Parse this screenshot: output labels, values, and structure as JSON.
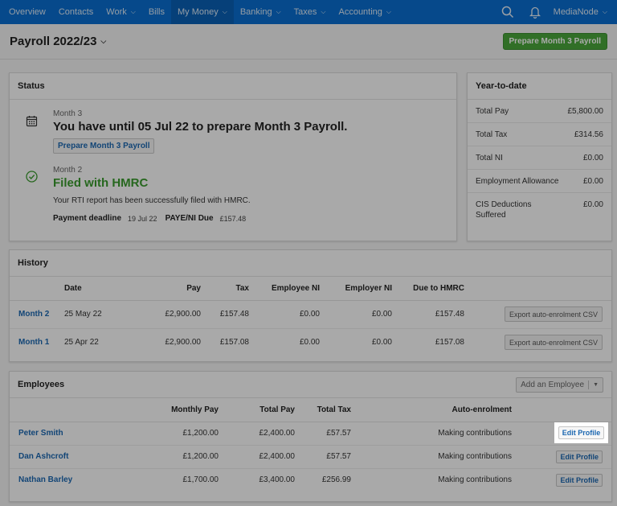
{
  "nav": {
    "items": [
      {
        "label": "Overview",
        "has_caret": false,
        "active": false
      },
      {
        "label": "Contacts",
        "has_caret": false,
        "active": false
      },
      {
        "label": "Work",
        "has_caret": true,
        "active": false
      },
      {
        "label": "Bills",
        "has_caret": false,
        "active": false
      },
      {
        "label": "My Money",
        "has_caret": true,
        "active": true
      },
      {
        "label": "Banking",
        "has_caret": true,
        "active": false
      },
      {
        "label": "Taxes",
        "has_caret": true,
        "active": false
      },
      {
        "label": "Accounting",
        "has_caret": true,
        "active": false
      }
    ],
    "search_icon": "search-icon",
    "notifications_icon": "bell-icon",
    "org_name": "MediaNode",
    "caret": "⌄"
  },
  "header": {
    "title": "Payroll 2022/23",
    "primary_button": "Prepare Month 3 Payroll"
  },
  "status": {
    "title": "Status",
    "current": {
      "month": "Month 3",
      "headline": "You have until 05 Jul 22 to prepare Month 3 Payroll.",
      "button": "Prepare Month 3 Payroll"
    },
    "previous": {
      "month": "Month 2",
      "headline": "Filed with HMRC",
      "message": "Your RTI report has been successfully filed with HMRC.",
      "payment_deadline_label": "Payment deadline",
      "payment_deadline_value": "19 Jul 22",
      "paye_label": "PAYE/NI Due",
      "paye_value": "£157.48"
    }
  },
  "ytd": {
    "title": "Year-to-date",
    "rows": [
      {
        "label": "Total Pay",
        "value": "£5,800.00"
      },
      {
        "label": "Total Tax",
        "value": "£314.56"
      },
      {
        "label": "Total NI",
        "value": "£0.00"
      },
      {
        "label": "Employment Allowance",
        "value": "£0.00"
      },
      {
        "label": "CIS Deductions Suffered",
        "value": "£0.00"
      }
    ]
  },
  "history": {
    "title": "History",
    "columns": [
      "",
      "Date",
      "Pay",
      "Tax",
      "Employee NI",
      "Employer NI",
      "Due to HMRC",
      ""
    ],
    "rows": [
      {
        "period": "Month 2",
        "date": "25 May 22",
        "pay": "£2,900.00",
        "tax": "£157.48",
        "employee_ni": "£0.00",
        "employer_ni": "£0.00",
        "due": "£157.48",
        "action": "Export auto-enrolment CSV"
      },
      {
        "period": "Month 1",
        "date": "25 Apr 22",
        "pay": "£2,900.00",
        "tax": "£157.08",
        "employee_ni": "£0.00",
        "employer_ni": "£0.00",
        "due": "£157.08",
        "action": "Export auto-enrolment CSV"
      }
    ]
  },
  "employees": {
    "title": "Employees",
    "add_button": "Add an Employee",
    "columns": [
      "",
      "Monthly Pay",
      "Total Pay",
      "Total Tax",
      "Auto-enrolment",
      ""
    ],
    "rows": [
      {
        "name": "Peter Smith",
        "monthly_pay": "£1,200.00",
        "total_pay": "£2,400.00",
        "total_tax": "£57.57",
        "auto_enrolment": "Making contributions",
        "action": "Edit Profile"
      },
      {
        "name": "Dan Ashcroft",
        "monthly_pay": "£1,200.00",
        "total_pay": "£2,400.00",
        "total_tax": "£57.57",
        "auto_enrolment": "Making contributions",
        "action": "Edit Profile"
      },
      {
        "name": "Nathan Barley",
        "monthly_pay": "£1,700.00",
        "total_pay": "£3,400.00",
        "total_tax": "£256.99",
        "auto_enrolment": "Making contributions",
        "action": "Edit Profile"
      }
    ]
  },
  "colors": {
    "nav_bg": "#0a6ecf",
    "nav_active": "#0960b5",
    "primary_green": "#4aa63b",
    "link_blue": "#1b67b1",
    "success_green": "#3a9a2e"
  }
}
